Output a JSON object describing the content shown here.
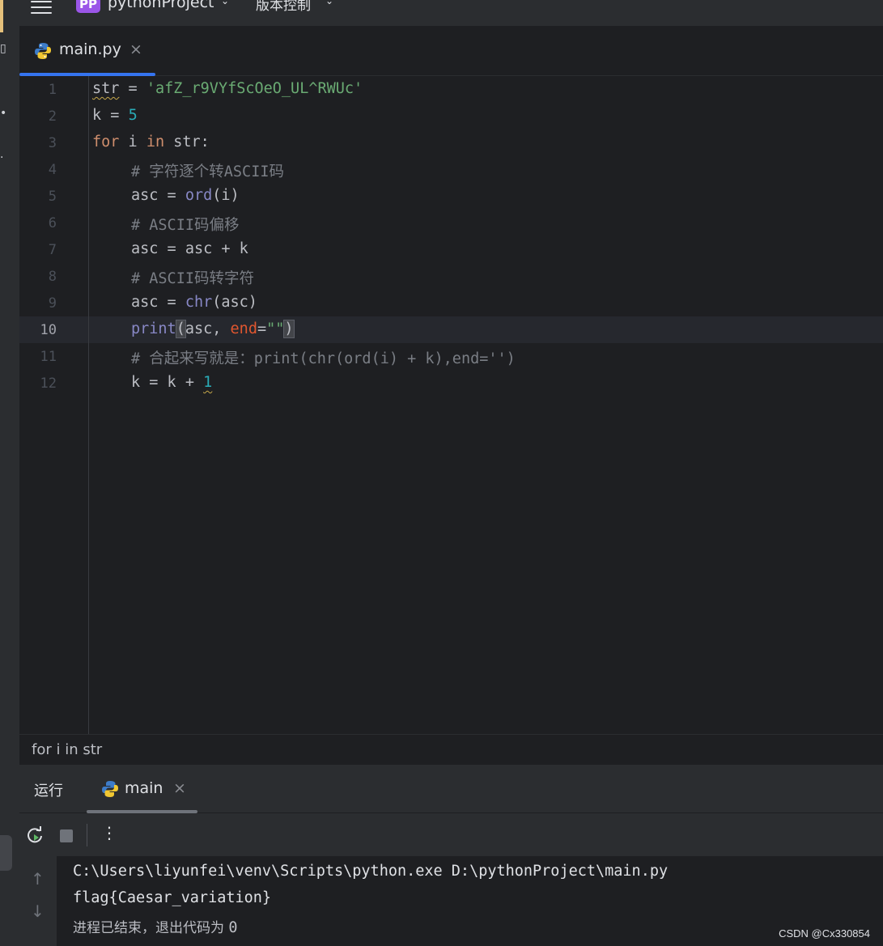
{
  "titlebar": {
    "project_badge": "PP",
    "project_name": "pythonProject",
    "vcs_label": "版本控制"
  },
  "editor_tab": {
    "file_name": "main.py",
    "close_glyph": "×"
  },
  "editor": {
    "current_line": "10",
    "line_numbers": [
      "1",
      "2",
      "3",
      "4",
      "5",
      "6",
      "7",
      "8",
      "9",
      "10",
      "11",
      "12"
    ],
    "lines": {
      "l1": {
        "var": "str",
        "op": " = ",
        "str": "'afZ_r9VYfScOeO_UL^RWUc'"
      },
      "l2": {
        "var": "k",
        "op": " = ",
        "num": "5"
      },
      "l3": {
        "kw1": "for",
        "t1": " i ",
        "kw2": "in",
        "t2": " str:"
      },
      "l4": {
        "comment": "# 字符逐个转ASCII码"
      },
      "l5": {
        "t1": "asc = ",
        "fn": "ord",
        "t2": "(i)"
      },
      "l6": {
        "comment": "# ASCII码偏移"
      },
      "l7": {
        "t1": "asc = asc + k"
      },
      "l8": {
        "comment": "# ASCII码转字符"
      },
      "l9": {
        "t1": "asc = ",
        "fn": "chr",
        "t2": "(asc)"
      },
      "l10": {
        "fn": "print",
        "paren_open": "(",
        "t1": "asc, ",
        "param": "end",
        "eq": "=",
        "str": "\"\"",
        "paren_close": ")"
      },
      "l11": {
        "comment": "# 合起来写就是：print(chr(ord(i) + k),end='')"
      },
      "l12": {
        "t1": "k = k + ",
        "num": "1"
      }
    }
  },
  "breadcrumb": {
    "text": "for i in str"
  },
  "run_panel": {
    "label": "运行",
    "tab_name": "main",
    "close_glyph": "×",
    "more_glyph": "⋮",
    "output": [
      "C:\\Users\\liyunfei\\venv\\Scripts\\python.exe D:\\pythonProject\\main.py",
      "flag{Caesar_variation}"
    ],
    "exit_text": "进程已结束，退出代码为 ",
    "exit_code": "0",
    "scroll_up_glyph": "↑",
    "scroll_down_glyph": "↓"
  },
  "watermark": "CSDN @Cx330854",
  "colors": {
    "accent": "#3574f0",
    "keyword": "#cf8e6d",
    "string": "#6aab73",
    "number": "#2aacb8",
    "builtin": "#8888c6",
    "comment": "#7a7e85",
    "badge": "#9b56e8"
  }
}
